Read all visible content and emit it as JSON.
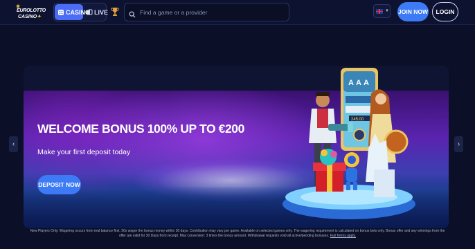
{
  "header": {
    "logo": {
      "line1": "EUROLOTTO",
      "line2": "CASINO",
      "line2_mark": "✦"
    },
    "tabs": [
      {
        "label": "CASINO",
        "icon": "casino-icon",
        "active": true
      },
      {
        "label": "LIVE",
        "icon": "live-cards-icon",
        "active": false
      }
    ],
    "trophy_icon": "trophy-icon",
    "search": {
      "placeholder": "Find a game or a provider",
      "value": ""
    },
    "language": {
      "icon": "uk-flag-icon",
      "chevron": "chevron-down-icon"
    },
    "join_label": "JOIN NOW",
    "login_label": "LOGIN"
  },
  "banner": {
    "title": "WELCOME BONUS 100% UP TO €200",
    "subtitle": "Make your first deposit today",
    "cta_label": "DEPOSIT NOW",
    "prev_arrow": "‹",
    "next_arrow": "›",
    "slot_symbols": [
      "A",
      "A",
      "A"
    ],
    "slot_amount": "245.00"
  },
  "terms": {
    "text": "New Players Only. Wagering occurs from real balance first. 50x wager the bonus money within 30 days. Contribution may vary per game. Available on selected games only. The wagering requirement is calculated on bonus bets only. Bonus offer and any winnings from the offer are valid for 30 Days from receipt. Max conversion: 3 times the bonus amount. Withdrawal requests void all active/pending bonuses.",
    "link_label": "Full Terms apply."
  },
  "colors": {
    "background": "#0b1028",
    "accent": "#3c7bf5",
    "casino_tab": "#4a6cf7",
    "logo_gold": "#f5c542"
  }
}
